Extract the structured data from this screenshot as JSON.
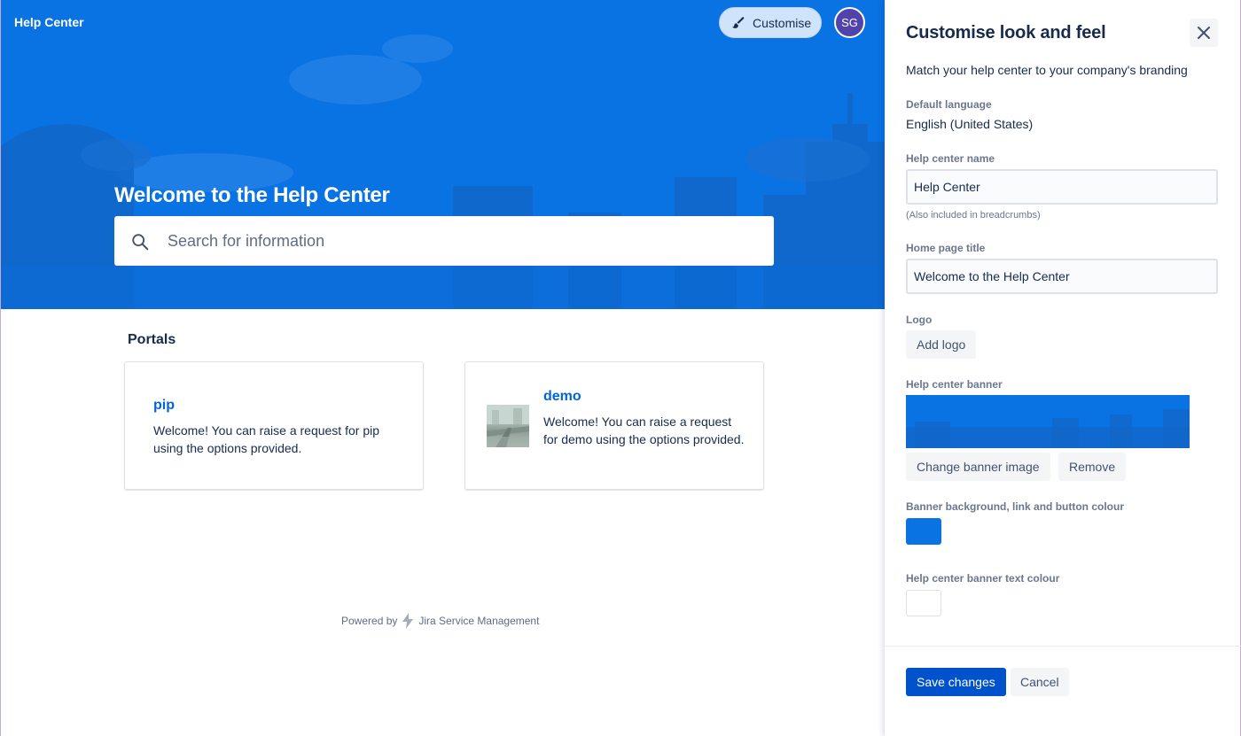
{
  "header": {
    "site_title": "Help Center",
    "customise_label": "Customise",
    "avatar_initials": "SG"
  },
  "hero": {
    "welcome_title": "Welcome to the Help Center",
    "search_placeholder": "Search for information"
  },
  "portals": {
    "heading": "Portals",
    "items": [
      {
        "title": "pip",
        "description": "Welcome! You can raise a request for pip using the options provided."
      },
      {
        "title": "demo",
        "description": "Welcome! You can raise a request for demo using the options provided."
      }
    ]
  },
  "footer": {
    "powered_by": "Powered by",
    "product": "Jira Service Management"
  },
  "panel": {
    "title": "Customise look and feel",
    "subtitle": "Match your help center to your company's branding",
    "default_language_label": "Default language",
    "default_language_value": "English (United States)",
    "name_label": "Help center name",
    "name_value": "Help Center",
    "name_hint": "(Also included in breadcrumbs)",
    "home_title_label": "Home page title",
    "home_title_value": "Welcome to the Help Center",
    "logo_label": "Logo",
    "add_logo": "Add logo",
    "banner_label": "Help center banner",
    "change_banner": "Change banner image",
    "remove": "Remove",
    "banner_color_label": "Banner background, link and button colour",
    "banner_color": "#0a73e4",
    "text_color_label": "Help center banner text colour",
    "text_color": "#ffffff",
    "save": "Save changes",
    "cancel": "Cancel"
  },
  "colors": {
    "brand": "#0a73e4",
    "primary_button": "#0052cc",
    "link": "#0065d6"
  },
  "icons": {
    "search": "search-icon",
    "brush": "paintbrush-icon",
    "close": "close-icon",
    "jsm": "lightning-bolt-icon"
  }
}
